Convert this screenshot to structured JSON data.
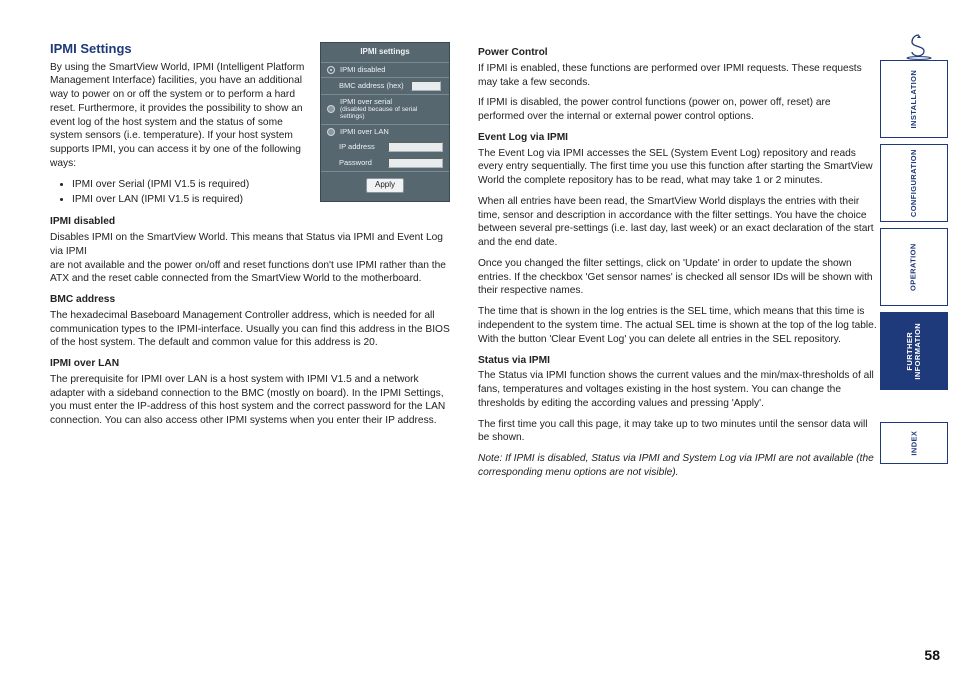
{
  "brand": "ADDER",
  "page_number": "58",
  "tabs": {
    "installation": "INSTALLATION",
    "configuration": "CONFIGURATION",
    "operation": "OPERATION",
    "further": "FURTHER\nINFORMATION",
    "index": "INDEX"
  },
  "left": {
    "title": "IPMI Settings",
    "intro": "By using the SmartView World, IPMI (Intelligent Platform Management Interface) facilities, you have an additional way to power on or off the system or to perform a hard reset. Furthermore, it provides the possibility to show an event log of the host system and the status of some system sensors (i.e. temperature). If your host system supports IPMI, you can access it by one of the following ways:",
    "bullets": [
      "IPMI over Serial (IPMI V1.5 is required)",
      "IPMI over LAN (IPMI V1.5 is required)"
    ],
    "h_disabled": "IPMI disabled",
    "p_disabled_1": "Disables IPMI on the SmartView World. This means that Status via IPMI and Event Log via IPMI",
    "p_disabled_2": "are not available and the power on/off and reset functions don't use IPMI rather than the ATX and the reset cable connected from the SmartView World to the motherboard.",
    "h_bmc": "BMC address",
    "p_bmc": "The hexadecimal Baseboard Management Controller address, which is needed for all communication types to the IPMI-interface. Usually you can find this address in the BIOS of the host system. The default and common value for this address is 20.",
    "h_lan": "IPMI over LAN",
    "p_lan": "The prerequisite for IPMI over LAN is a host system with IPMI V1.5 and a network adapter with a sideband connection to the BMC (mostly on board). In the IPMI Settings, you must enter the IP-address of this host system and the correct password for the LAN connection. You can also access other IPMI systems when you enter their IP address."
  },
  "right": {
    "h_power": "Power Control",
    "p_power_1": "If IPMI is enabled, these functions are performed over IPMI requests. These requests may take a few seconds.",
    "p_power_2": "If IPMI is disabled, the power control functions (power on, power off, reset) are performed over the internal or external power control options.",
    "h_event": "Event Log via IPMI",
    "p_event_1": "The Event Log via IPMI accesses the SEL (System Event Log) repository and reads every entry sequentially. The first time you use this function after starting the SmartView World the complete repository has to be read, what may take 1 or 2 minutes.",
    "p_event_2": "When all entries have been read, the SmartView World displays the entries with their time, sensor and description in accordance with the filter settings. You have the choice between several pre-settings (i.e. last day, last week) or an exact declaration of the start and the end date.",
    "p_event_3": "Once you changed the filter settings, click on 'Update' in order to update the shown entries. If the checkbox 'Get sensor names' is checked all sensor IDs will be shown with their respective names.",
    "p_event_4": "The time that is shown in the log entries is the SEL time, which means that this time is independent to the system time. The actual SEL time is shown at the top of the log table. With the button 'Clear Event Log' you can delete all entries in the SEL repository.",
    "h_status": "Status via IPMI",
    "p_status_1": "The Status via IPMI function shows the current values and the min/max-thresholds of all fans, temperatures and voltages existing in the host system. You can change the thresholds by editing the according values and pressing 'Apply'.",
    "p_status_2": "The first time you call this page, it may take up to two minutes until the sensor data will be shown.",
    "note": "Note: If IPMI is disabled, Status via IPMI and System Log via IPMI are not available (the corresponding menu options are not visible)."
  },
  "shot": {
    "title": "IPMI settings",
    "opt_disabled": "IPMI disabled",
    "lbl_bmc": "BMC address (hex)",
    "opt_serial": "IPMI over serial",
    "serial_note": "(disabled because of serial settings)",
    "opt_lan": "IPMI over LAN",
    "lbl_ip": "IP address",
    "lbl_pwd": "Password",
    "apply": "Apply"
  }
}
